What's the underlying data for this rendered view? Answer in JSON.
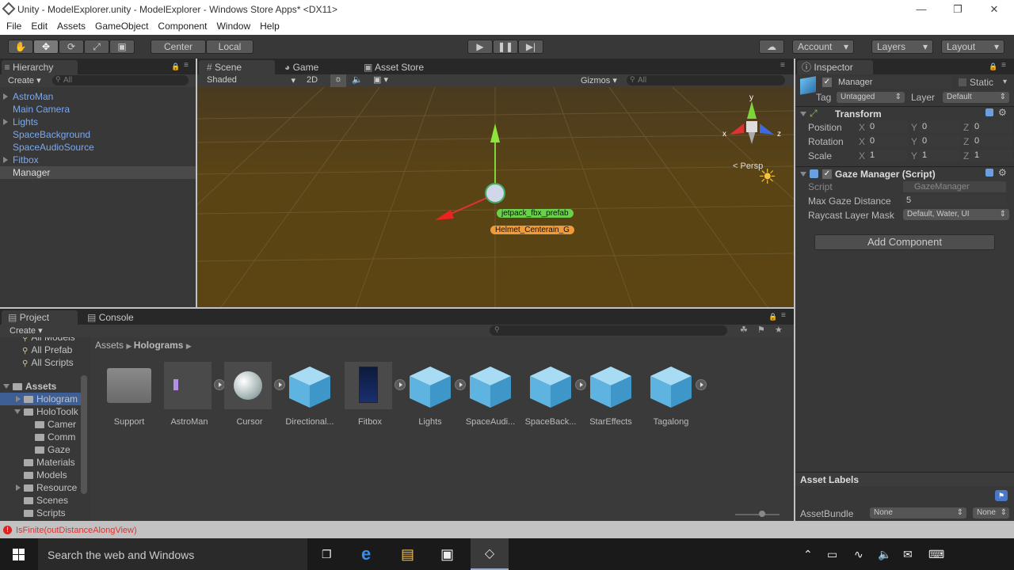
{
  "window": {
    "title": "Unity - ModelExplorer.unity - ModelExplorer - Windows Store Apps* <DX11>",
    "minimize": "—",
    "maximize": "❐",
    "close": "✕"
  },
  "menu": [
    "File",
    "Edit",
    "Assets",
    "GameObject",
    "Component",
    "Window",
    "Help"
  ],
  "toolbar": {
    "pivot": "Center",
    "space": "Local",
    "account": "Account",
    "layers": "Layers",
    "layout": "Layout"
  },
  "hierarchy": {
    "tab": "Hierarchy",
    "create": "Create",
    "search_placeholder": "All",
    "items": [
      "AstroMan",
      "Main Camera",
      "Lights",
      "SpaceBackground",
      "SpaceAudioSource",
      "Fitbox",
      "Manager"
    ]
  },
  "scene": {
    "tabs": [
      "Scene",
      "Game",
      "Asset Store"
    ],
    "shading": "Shaded",
    "mode2d": "2D",
    "gizmos": "Gizmos",
    "search_placeholder": "All",
    "persp": "< Persp",
    "axis_x": "x",
    "axis_y": "y",
    "axis_z": "z",
    "labels": [
      "jetpack_fbx_prefab",
      "Helmet_Centerain_G"
    ]
  },
  "inspector": {
    "tab": "Inspector",
    "object_name": "Manager",
    "static": "Static",
    "tag_label": "Tag",
    "tag_value": "Untagged",
    "layer_label": "Layer",
    "layer_value": "Default",
    "transform": {
      "title": "Transform",
      "rows": [
        {
          "label": "Position",
          "x": "0",
          "y": "0",
          "z": "0"
        },
        {
          "label": "Rotation",
          "x": "0",
          "y": "0",
          "z": "0"
        },
        {
          "label": "Scale",
          "x": "1",
          "y": "1",
          "z": "1"
        }
      ],
      "x": "X",
      "y": "Y",
      "z": "Z"
    },
    "gaze": {
      "title": "Gaze Manager (Script)",
      "script_label": "Script",
      "script_value": "GazeManager",
      "max_label": "Max Gaze Distance",
      "max_value": "5",
      "mask_label": "Raycast Layer Mask",
      "mask_value": "Default, Water, UI"
    },
    "add_component": "Add Component",
    "asset_labels": "Asset Labels",
    "assetbundle_label": "AssetBundle",
    "assetbundle_value": "None",
    "assetbundle_variant": "None"
  },
  "project": {
    "tabs": [
      "Project",
      "Console"
    ],
    "create": "Create",
    "favorites": [
      "All Models",
      "All Prefab",
      "All Scripts"
    ],
    "tree": [
      {
        "label": "Assets",
        "indent": 0,
        "expanded": true,
        "bold": true
      },
      {
        "label": "Hologram",
        "indent": 1,
        "selected": true
      },
      {
        "label": "HoloToolk",
        "indent": 1,
        "expanded": true
      },
      {
        "label": "Camer",
        "indent": 2
      },
      {
        "label": "Comm",
        "indent": 2
      },
      {
        "label": "Gaze",
        "indent": 2
      },
      {
        "label": "Materials",
        "indent": 1
      },
      {
        "label": "Models",
        "indent": 1
      },
      {
        "label": "Resource",
        "indent": 1
      },
      {
        "label": "Scenes",
        "indent": 1
      },
      {
        "label": "Scripts",
        "indent": 1
      }
    ],
    "breadcrumb": [
      "Assets",
      "Holograms"
    ],
    "assets": [
      "Support",
      "AstroMan",
      "Cursor",
      "Directional...",
      "Fitbox",
      "Lights",
      "SpaceAudi...",
      "SpaceBack...",
      "StarEffects",
      "Tagalong"
    ]
  },
  "status": {
    "error": "IsFinite(outDistanceAlongView)"
  },
  "taskbar": {
    "search": "Search the web and Windows"
  }
}
